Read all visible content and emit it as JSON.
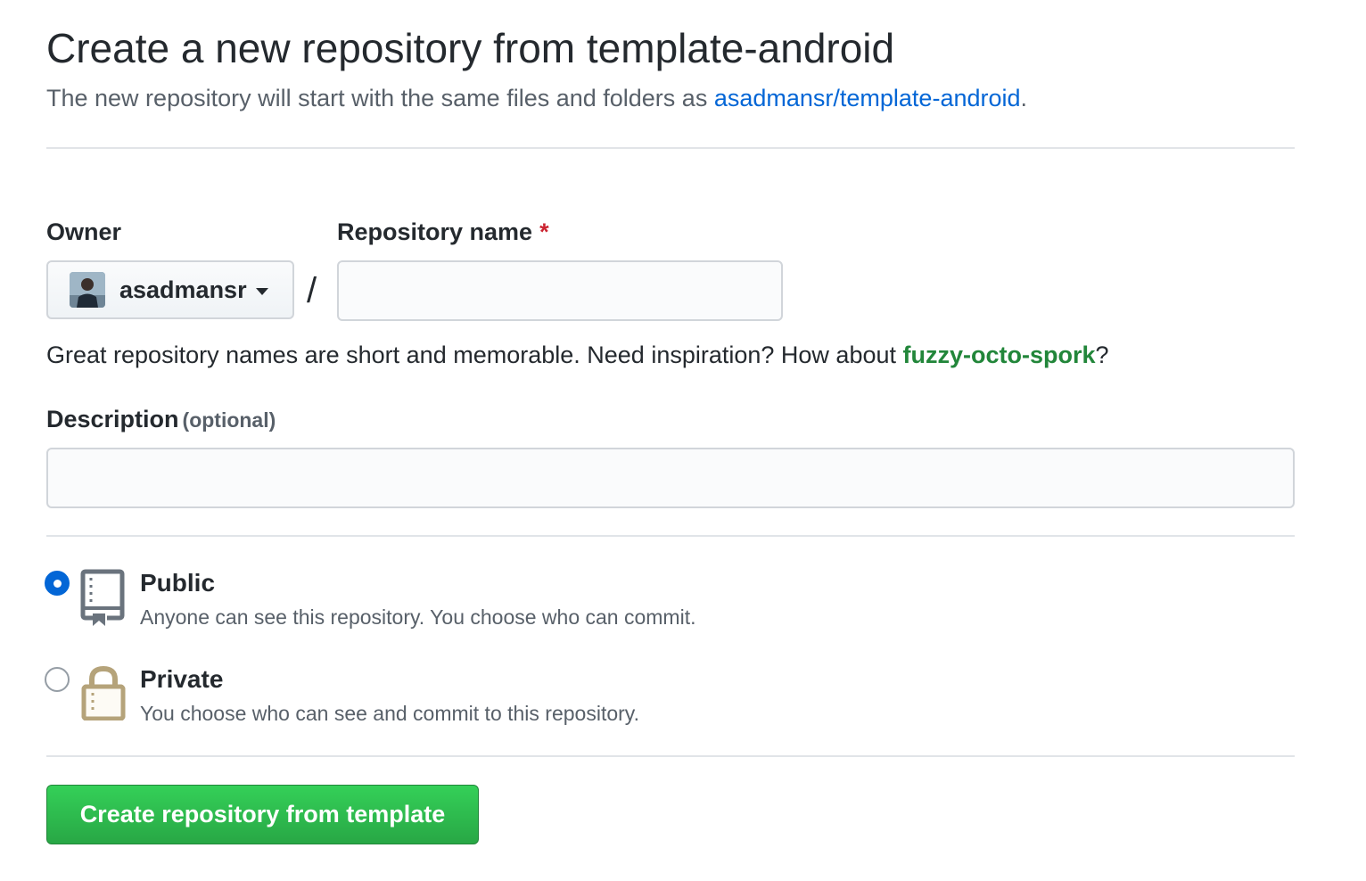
{
  "header": {
    "title": "Create a new repository from template-android",
    "subtitle_prefix": "The new repository will start with the same files and folders as ",
    "template_link": "asadmansr/template-android",
    "subtitle_suffix": "."
  },
  "owner": {
    "label": "Owner",
    "selected": "asadmansr",
    "avatar_icon": "user-avatar"
  },
  "separator": "/",
  "repo_name": {
    "label": "Repository name",
    "required_marker": "*",
    "value": ""
  },
  "hint": {
    "prefix": "Great repository names are short and memorable. Need inspiration? How about ",
    "suggestion": "fuzzy-octo-spork",
    "suffix": "?"
  },
  "description": {
    "label": "Description",
    "optional_note": "(optional)",
    "value": ""
  },
  "visibility": {
    "public": {
      "title": "Public",
      "description": "Anyone can see this repository. You choose who can commit.",
      "icon": "repo-icon",
      "checked": true
    },
    "private": {
      "title": "Private",
      "description": "You choose who can see and commit to this repository.",
      "icon": "lock-icon",
      "checked": false
    }
  },
  "submit": {
    "label": "Create repository from template"
  },
  "colors": {
    "link": "#0366d6",
    "suggestion": "#22863a",
    "primary_button": "#28a745",
    "required": "#cb2431",
    "radio_checked": "#0366d6",
    "icon_private": "#b08800"
  }
}
